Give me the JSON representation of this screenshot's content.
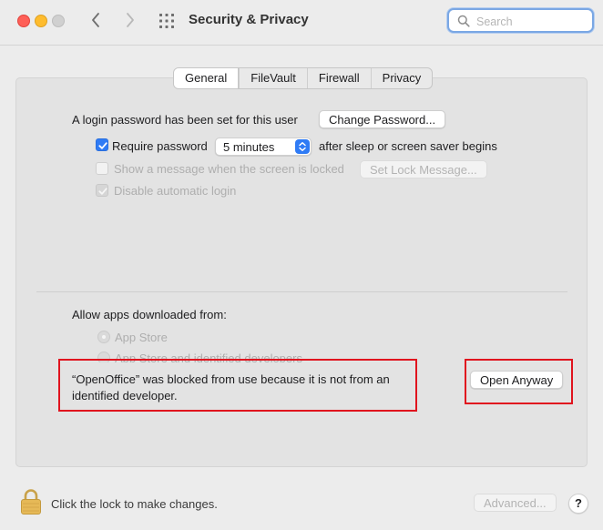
{
  "window": {
    "title": "Security & Privacy"
  },
  "search": {
    "placeholder": "Search"
  },
  "tabs": [
    {
      "label": "General",
      "active": true
    },
    {
      "label": "FileVault",
      "active": false
    },
    {
      "label": "Firewall",
      "active": false
    },
    {
      "label": "Privacy",
      "active": false
    }
  ],
  "general": {
    "login_text": "A login password has been set for this user",
    "change_password_label": "Change Password...",
    "require_password_label": "Require password",
    "require_password_checked": true,
    "require_password_value": "5 minutes",
    "after_sleep_text": "after sleep or screen saver begins",
    "show_message_label": "Show a message when the screen is locked",
    "set_lock_message_label": "Set Lock Message...",
    "disable_autologin_label": "Disable automatic login"
  },
  "apps": {
    "heading": "Allow apps downloaded from:",
    "options": [
      {
        "label": "App Store",
        "selected": false
      },
      {
        "label": "App Store and identified developers",
        "selected": false
      }
    ],
    "blocked_message": "“OpenOffice” was blocked from use because it is not from an identified developer.",
    "open_anyway_label": "Open Anyway"
  },
  "footer": {
    "lock_text": "Click the lock to make changes.",
    "advanced_label": "Advanced...",
    "help_label": "?"
  },
  "colors": {
    "accent": "#2f7bf5",
    "highlight_box": "#e0141e"
  }
}
